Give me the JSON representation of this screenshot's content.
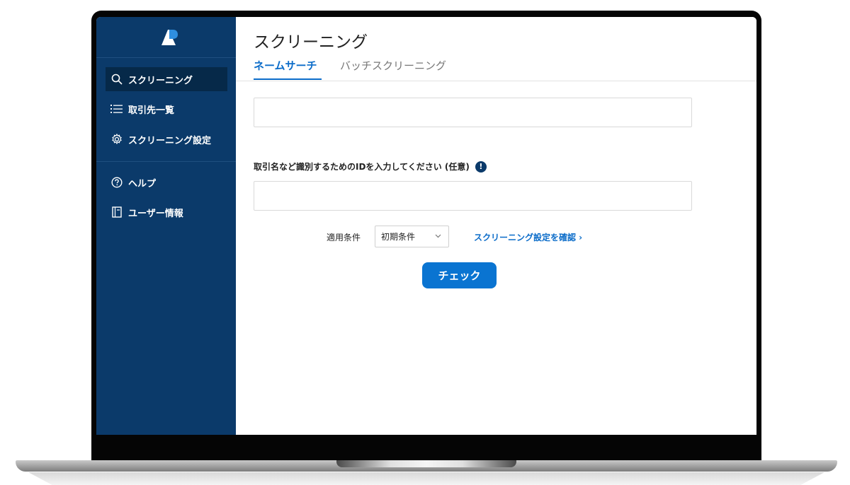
{
  "sidebar": {
    "logo_icon": "brand-logo",
    "items": [
      {
        "label": "スクリーニング",
        "icon": "search-icon",
        "active": true
      },
      {
        "label": "取引先一覧",
        "icon": "list-icon",
        "active": false
      },
      {
        "label": "スクリーニング設定",
        "icon": "gear-icon",
        "active": false
      },
      {
        "label": "ヘルプ",
        "icon": "help-icon",
        "active": false
      },
      {
        "label": "ユーザー情報",
        "icon": "book-icon",
        "active": false
      }
    ]
  },
  "main": {
    "title": "スクリーニング",
    "tabs": [
      {
        "label": "ネームサーチ",
        "active": true
      },
      {
        "label": "バッチスクリーニング",
        "active": false
      }
    ],
    "name_input": {
      "value": "",
      "placeholder": ""
    },
    "id_field": {
      "label": "取引名など識別するためのIDを入力してください (任意)",
      "info_icon": "!",
      "value": "",
      "placeholder": ""
    },
    "condition": {
      "label": "適用条件",
      "selected": "初期条件",
      "link": "スクリーニング設定を確認 ›"
    },
    "check_button": "チェック"
  },
  "colors": {
    "sidebar_bg": "#0b3a6a",
    "sidebar_active": "#062949",
    "accent": "#0b6cc9",
    "button": "#0a74d1"
  }
}
